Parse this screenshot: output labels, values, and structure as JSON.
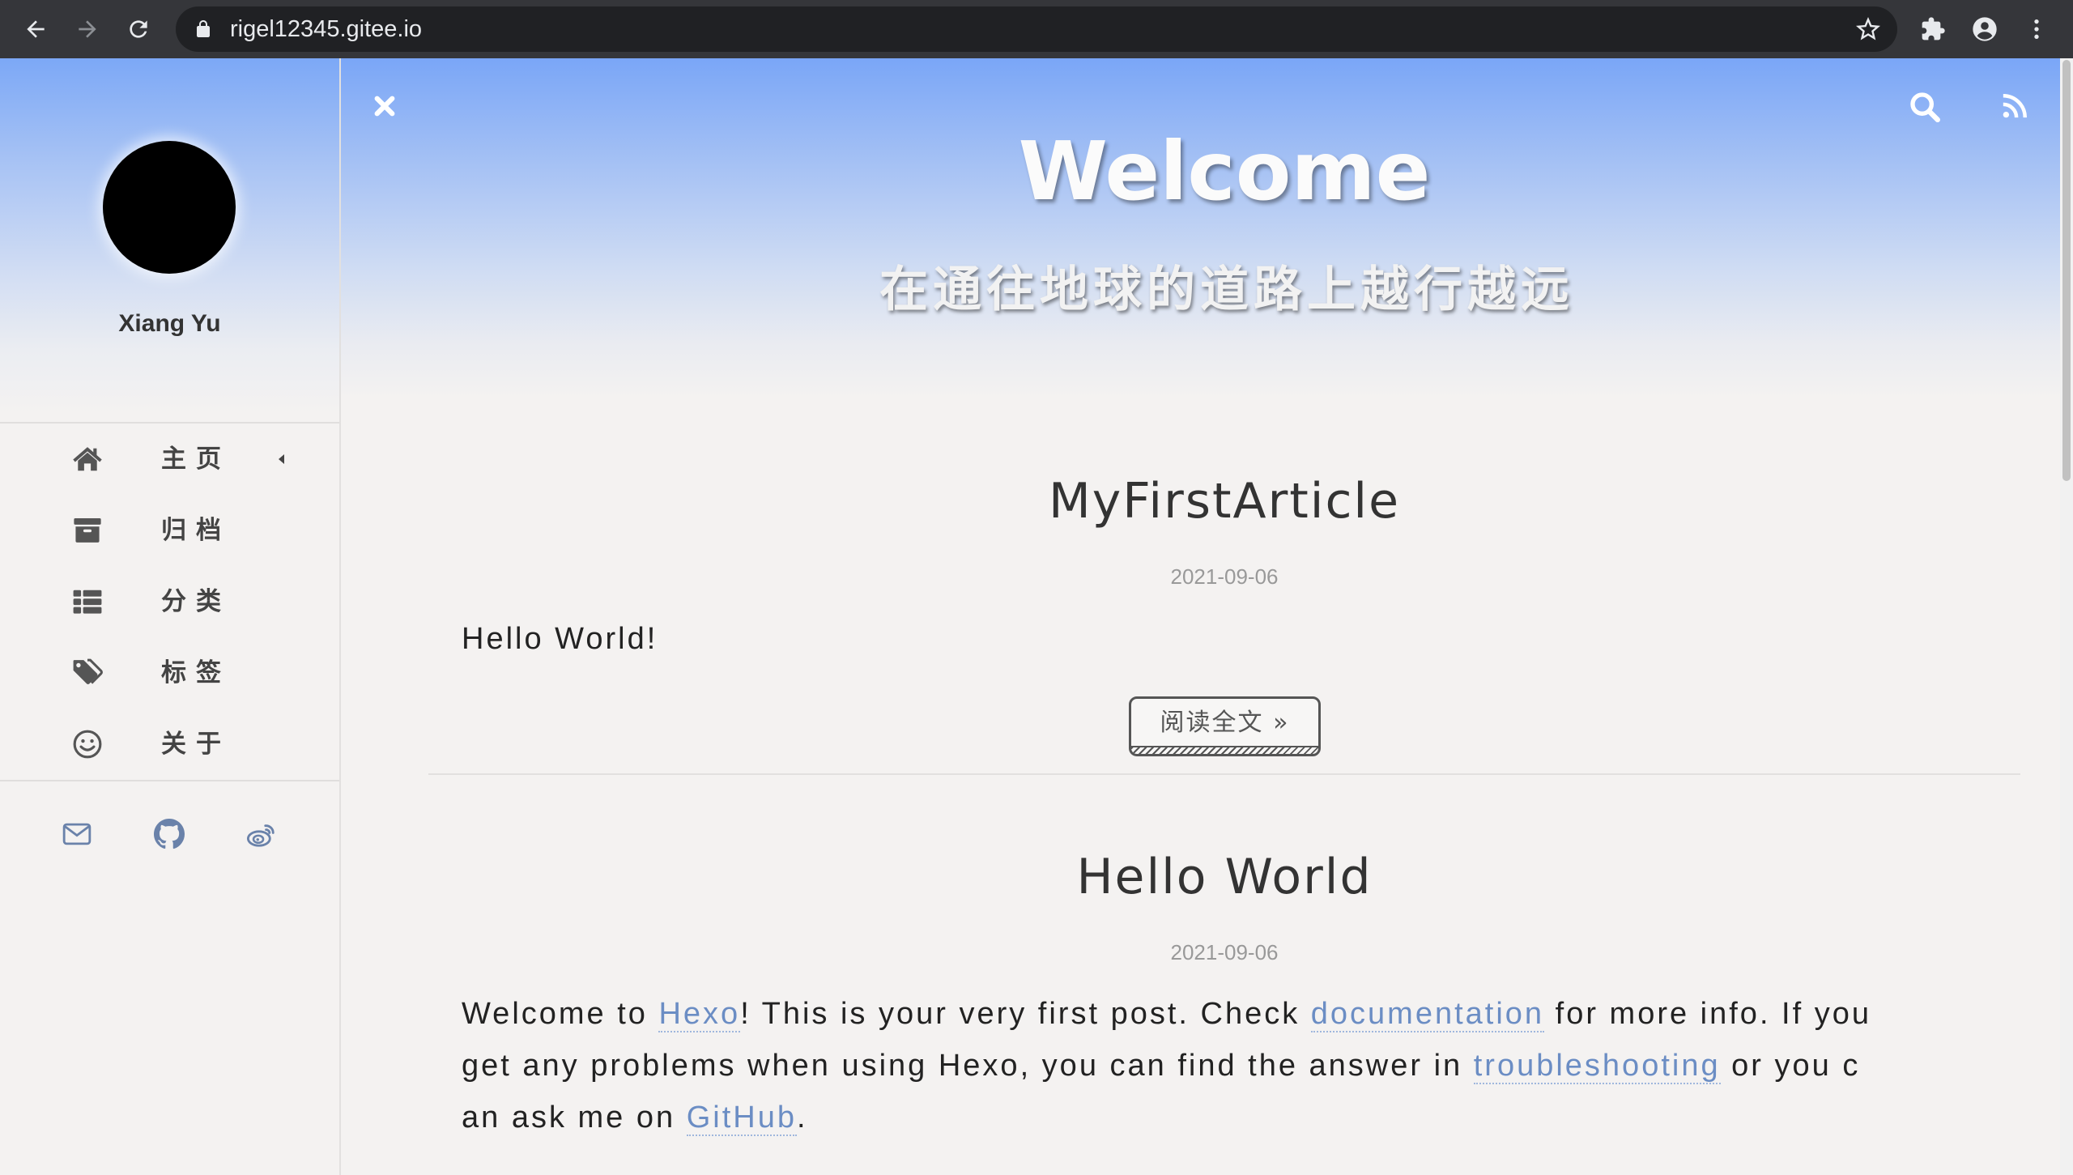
{
  "browser": {
    "url": "rigel12345.gitee.io",
    "icons": [
      "back-arrow-icon",
      "forward-arrow-icon",
      "reload-icon",
      "lock-icon",
      "star-icon",
      "extensions-icon",
      "profile-icon",
      "menu-dots-icon"
    ]
  },
  "sidebar": {
    "author": "Xiang Yu",
    "menu": [
      {
        "label": "主页",
        "icon": "home-icon",
        "expanded_caret": "caret-left-icon"
      },
      {
        "label": "归档",
        "icon": "archive-icon"
      },
      {
        "label": "分类",
        "icon": "list-icon"
      },
      {
        "label": "标签",
        "icon": "tags-icon"
      },
      {
        "label": "关于",
        "icon": "smile-icon"
      }
    ],
    "social": [
      {
        "icon": "mail-icon"
      },
      {
        "icon": "github-icon"
      },
      {
        "icon": "weibo-icon"
      }
    ]
  },
  "header": {
    "title": "Welcome",
    "subtitle": "在通往地球的道路上越行越远",
    "icons": [
      "close-icon",
      "search-icon",
      "rss-icon"
    ]
  },
  "posts": [
    {
      "title": "MyFirstArticle",
      "date": "2021-09-06",
      "excerpt": "Hello World!",
      "read_more": "阅读全文 »"
    },
    {
      "title": "Hello World",
      "date": "2021-09-06",
      "excerpt_lines": [
        [
          {
            "text": "Welcome to "
          },
          {
            "link": "Hexo"
          },
          {
            "text": "! This is your very first post. Check "
          },
          {
            "link": "documentation"
          },
          {
            "text": " for more info. If you"
          }
        ],
        [
          {
            "text": "get any problems when using Hexo, you can find the answer in "
          },
          {
            "link": "troubleshooting"
          },
          {
            "text": " or you c"
          }
        ],
        [
          {
            "text": "an ask me on "
          },
          {
            "link": "GitHub"
          },
          {
            "text": "."
          }
        ]
      ]
    }
  ],
  "colors": {
    "header_blue": "#7aa6f7",
    "background": "#f4f2f1",
    "link": "#6b8dc4",
    "text": "#222222",
    "muted": "#999999",
    "chrome_toolbar": "#35363a",
    "chrome_omnibox": "#202124"
  }
}
